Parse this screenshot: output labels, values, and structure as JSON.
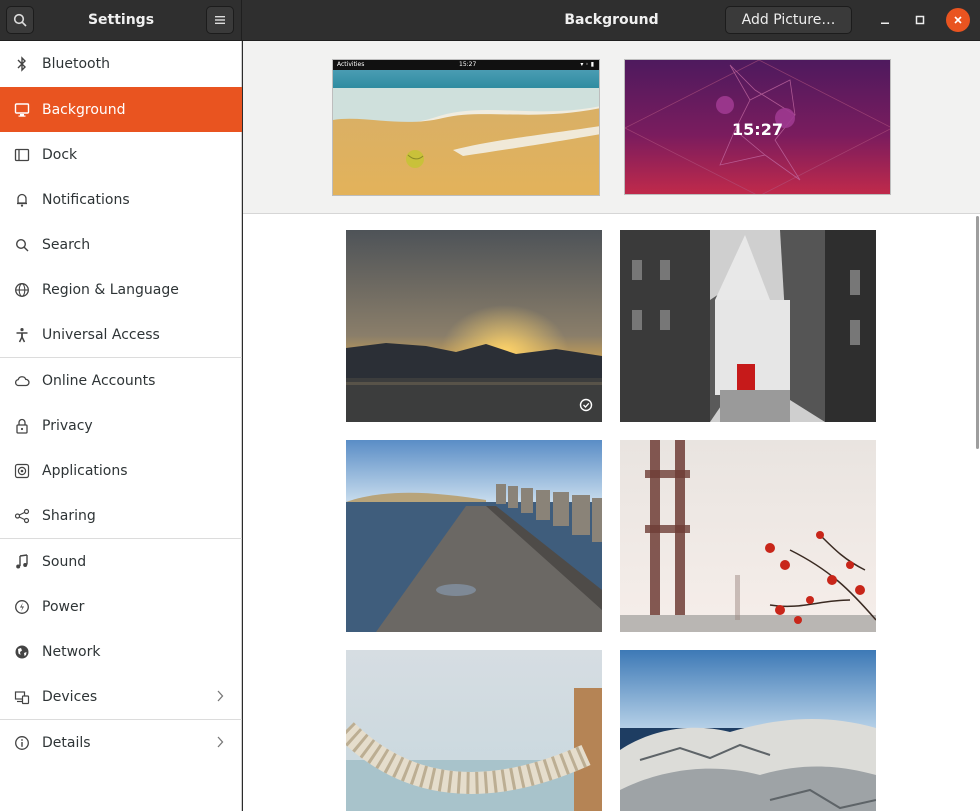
{
  "window": {
    "sidebar_title": "Settings",
    "panel_title": "Background",
    "add_picture_label": "Add Picture…"
  },
  "sidebar": {
    "items": [
      {
        "label": "Bluetooth",
        "icon": "bluetooth-icon"
      },
      {
        "label": "Background",
        "icon": "monitor-icon",
        "active": true
      },
      {
        "label": "Dock",
        "icon": "dock-icon"
      },
      {
        "label": "Notifications",
        "icon": "bell-icon"
      },
      {
        "label": "Search",
        "icon": "search-icon"
      },
      {
        "label": "Region & Language",
        "icon": "globe-icon"
      },
      {
        "label": "Universal Access",
        "icon": "accessibility-icon"
      },
      {
        "label": "Online Accounts",
        "icon": "cloud-icon"
      },
      {
        "label": "Privacy",
        "icon": "lock-icon"
      },
      {
        "label": "Applications",
        "icon": "gear-icon"
      },
      {
        "label": "Sharing",
        "icon": "share-icon"
      },
      {
        "label": "Sound",
        "icon": "music-note-icon"
      },
      {
        "label": "Power",
        "icon": "power-icon"
      },
      {
        "label": "Network",
        "icon": "network-globe-icon"
      },
      {
        "label": "Devices",
        "icon": "devices-icon",
        "chevron": true
      },
      {
        "label": "Details",
        "icon": "info-icon",
        "chevron": true
      }
    ]
  },
  "previews": {
    "desktop_topbar_left": "Activities",
    "desktop_topbar_time": "15:27",
    "lock_time": "15:27"
  },
  "wallpapers": [
    {
      "name": "sunset-over-water",
      "selected": true
    },
    {
      "name": "bw-church-street",
      "selected": false
    },
    {
      "name": "stone-pier",
      "selected": false
    },
    {
      "name": "bridge-and-flowers",
      "selected": false
    },
    {
      "name": "rope-fence",
      "selected": false
    },
    {
      "name": "icy-rocks",
      "selected": false
    }
  ],
  "colors": {
    "accent": "#e95420",
    "headerbar": "#2f2f2f"
  }
}
